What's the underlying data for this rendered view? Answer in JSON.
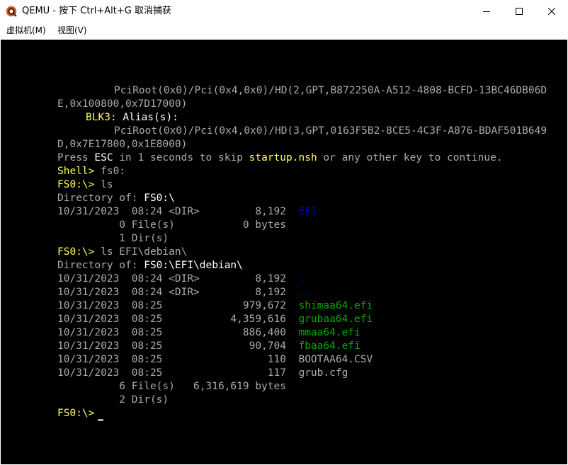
{
  "window": {
    "title": "QEMU - 按下 Ctrl+Alt+G 取消捕获",
    "minimize_glyph": "—",
    "maximize_glyph": "☐",
    "close_glyph": "✕"
  },
  "menu": {
    "machine": "虚拟机(M)",
    "view": "视图(V)"
  },
  "colors": {
    "default_text": "#aaaaaa",
    "bright_white": "#ffffff",
    "yellow": "#ffff55",
    "green": "#00aa00",
    "blue": "#0000aa"
  },
  "console": {
    "l01": "PciRoot(0x0)/Pci(0x4,0x0)/HD(2,GPT,B872250A-A512-4808-BCFD-13BC46DB06D",
    "l02": "E,0x100800,0x7D17000)",
    "l03_label": "BLK3:",
    "l03_rest": " Alias(s):",
    "l04": "PciRoot(0x0)/Pci(0x4,0x0)/HD(3,GPT,0163F5B2-8CE5-4C3F-A876-BDAF501B649",
    "l05": "D,0x7E17800,0x1E8000)",
    "l06_a": "Press ",
    "l06_esc": "ESC",
    "l06_b": " in 1 seconds to skip ",
    "l06_nsh": "startup.nsh",
    "l06_c": " or any other key to continue.",
    "l07_prompt": "Shell>",
    "l07_cmd": " fs0:",
    "l08_prompt": "FS0:\\>",
    "l08_cmd": " ls",
    "l09_a": "Directory of: ",
    "l09_b": "FS0:\\",
    "l10_a": "10/31/2023  08:24 <DIR>         8,192  ",
    "l10_b": "EFI",
    "l11": "          0 File(s)           0 bytes",
    "l12": "          1 Dir(s)",
    "l13_prompt": "FS0:\\>",
    "l13_cmd": " ls EFI\\debian\\",
    "l14_a": "Directory of: ",
    "l14_b": "FS0:\\EFI\\debian\\",
    "l15_a": "10/31/2023  08:24 <DIR>         8,192  ",
    "l15_b": ".",
    "l16_a": "10/31/2023  08:24 <DIR>         8,192  ",
    "l16_b": "..",
    "l17_a": "10/31/2023  08:25             979,672  ",
    "l17_b": "shimaa64.efi",
    "l18_a": "10/31/2023  08:25           4,359,616  ",
    "l18_b": "grubaa64.efi",
    "l19_a": "10/31/2023  08:25             886,400  ",
    "l19_b": "mmaa64.efi",
    "l20_a": "10/31/2023  08:25              90,704  ",
    "l20_b": "fbaa64.efi",
    "l21": "10/31/2023  08:25                 110  BOOTAA64.CSV",
    "l22": "10/31/2023  08:25                 117  grub.cfg",
    "l23": "          6 File(s)   6,316,619 bytes",
    "l24": "          2 Dir(s)",
    "l25_prompt": "FS0:\\>",
    "l25_cmd": " "
  }
}
